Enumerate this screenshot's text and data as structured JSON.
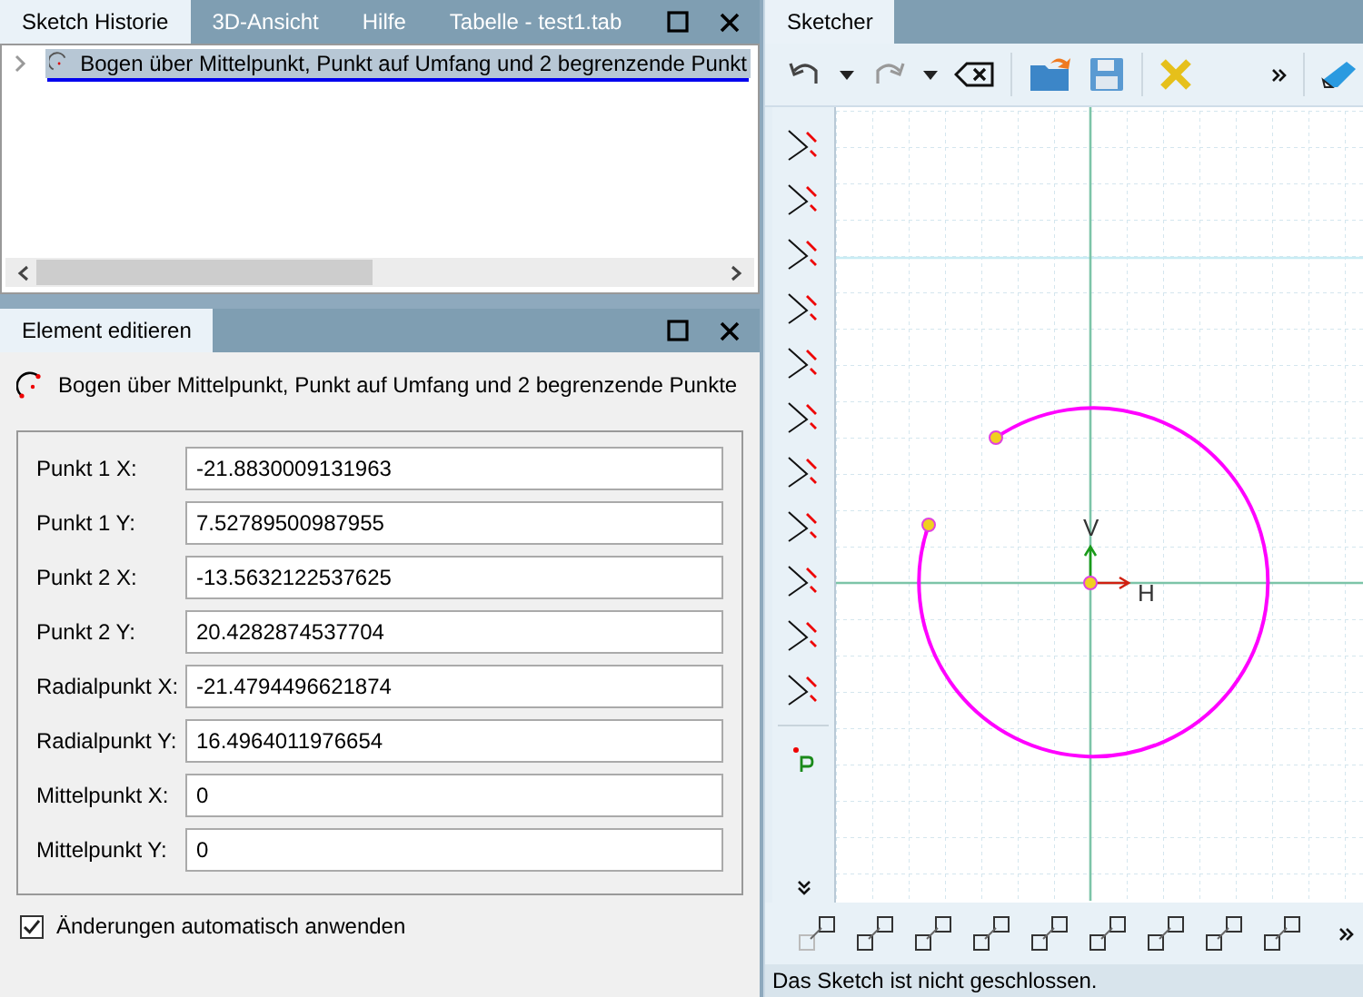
{
  "history_panel": {
    "tabs": [
      {
        "label": "Sketch Historie",
        "selected": true
      },
      {
        "label": "3D-Ansicht",
        "selected": false
      },
      {
        "label": "Hilfe",
        "selected": false
      },
      {
        "label": "Tabelle - test1.tab",
        "selected": false
      }
    ],
    "tree": [
      {
        "label": "Bogen über Mittelpunkt, Punkt auf Umfang und 2 begrenzende Punkt",
        "expanded": false,
        "selected": true
      }
    ]
  },
  "edit_panel": {
    "tab": "Element editieren",
    "heading": "Bogen über Mittelpunkt, Punkt auf Umfang und 2 begrenzende Punkte",
    "fields": [
      {
        "label": "Punkt 1 X:",
        "value": "-21.8830009131963"
      },
      {
        "label": "Punkt 1 Y:",
        "value": "7.52789500987955"
      },
      {
        "label": "Punkt 2 X:",
        "value": "-13.5632122537625"
      },
      {
        "label": "Punkt 2 Y:",
        "value": "20.4282874537704"
      },
      {
        "label": "Radialpunkt X:",
        "value": "-21.4794496621874"
      },
      {
        "label": "Radialpunkt Y:",
        "value": "16.4964011976654"
      },
      {
        "label": "Mittelpunkt X:",
        "value": "0"
      },
      {
        "label": "Mittelpunkt Y:",
        "value": "0"
      }
    ],
    "auto_apply": {
      "label": "Änderungen automatisch anwenden",
      "checked": true
    }
  },
  "sketcher": {
    "tab": "Sketcher",
    "axis_labels": {
      "vertical": "V",
      "horizontal": "H"
    },
    "status_bar": "Das Sketch ist nicht geschlossen."
  }
}
